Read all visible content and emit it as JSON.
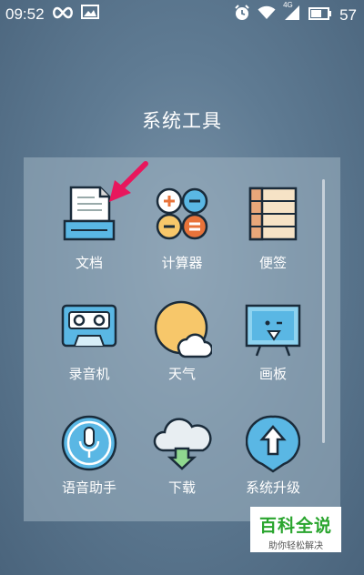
{
  "status_bar": {
    "time": "09:52",
    "battery": "57",
    "signal_label": "4G",
    "left_icons": [
      "infinity-icon",
      "image-icon"
    ],
    "right_icons": [
      "alarm-icon",
      "wifi-icon",
      "signal-icon",
      "battery-icon"
    ]
  },
  "folder": {
    "title": "系统工具",
    "apps": [
      {
        "label": "文档",
        "icon": "document-icon"
      },
      {
        "label": "计算器",
        "icon": "calculator-icon"
      },
      {
        "label": "便签",
        "icon": "notes-icon"
      },
      {
        "label": "录音机",
        "icon": "cassette-icon"
      },
      {
        "label": "天气",
        "icon": "weather-icon"
      },
      {
        "label": "画板",
        "icon": "drawing-board-icon"
      },
      {
        "label": "语音助手",
        "icon": "microphone-icon"
      },
      {
        "label": "下载",
        "icon": "cloud-download-icon"
      },
      {
        "label": "系统升级",
        "icon": "upgrade-arrow-icon"
      }
    ]
  },
  "watermark": {
    "title": "百科全说",
    "subtitle": "助你轻松解决"
  },
  "colors": {
    "arrow": "#e8175d",
    "watermark_green": "#2aa52e",
    "icon_outline": "#1a2b3a"
  }
}
